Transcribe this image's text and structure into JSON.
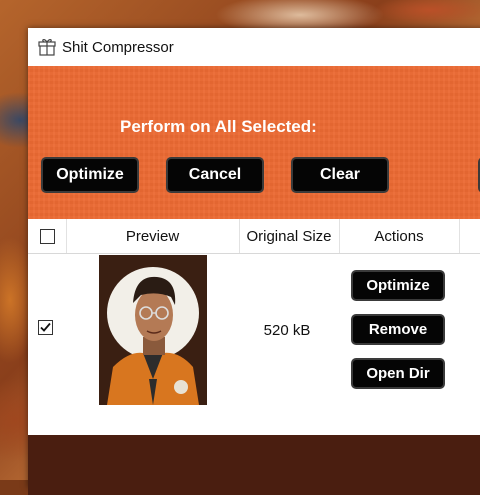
{
  "window": {
    "title": "Shit Compressor",
    "icon": "gift-box-icon"
  },
  "bulk_actions": {
    "label": "Perform on All Selected:",
    "buttons": [
      "Optimize",
      "Cancel",
      "Clear"
    ]
  },
  "table": {
    "select_all_checked": false,
    "columns": [
      "Preview",
      "Original Size",
      "Actions"
    ],
    "rows": [
      {
        "checked": true,
        "preview": "portrait-illustration-thumbnail",
        "original_size": "520 kB",
        "actions": [
          "Optimize",
          "Remove",
          "Open Dir"
        ]
      }
    ]
  },
  "colors": {
    "accent_orange": "#ec6a33",
    "button_black": "#050505",
    "footer_brown": "#4a1e10"
  }
}
